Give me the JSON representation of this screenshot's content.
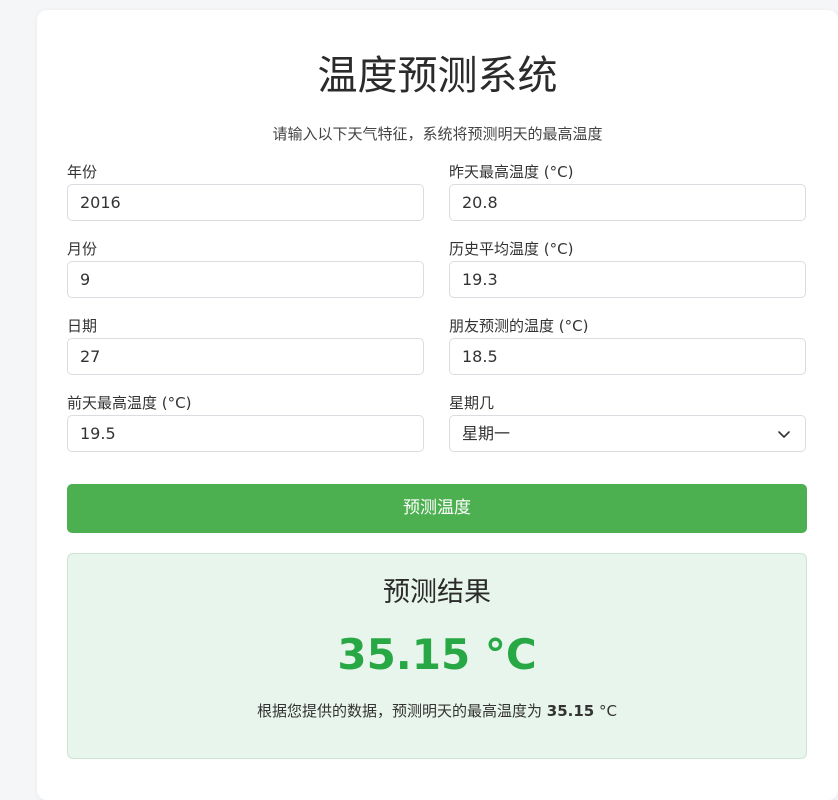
{
  "header": {
    "title": "温度预测系统",
    "subtitle": "请输入以下天气特征，系统将预测明天的最高温度"
  },
  "form": {
    "year": {
      "label": "年份",
      "value": "2016"
    },
    "month": {
      "label": "月份",
      "value": "9"
    },
    "day": {
      "label": "日期",
      "value": "27"
    },
    "temp_2": {
      "label": "前天最高温度 (°C)",
      "value": "19.5"
    },
    "temp_1": {
      "label": "昨天最高温度 (°C)",
      "value": "20.8"
    },
    "average": {
      "label": "历史平均温度 (°C)",
      "value": "19.3"
    },
    "friend": {
      "label": "朋友预测的温度 (°C)",
      "value": "18.5"
    },
    "week": {
      "label": "星期几",
      "value": "星期一",
      "icon": "chevron-down-icon"
    }
  },
  "actions": {
    "predict_label": "预测温度"
  },
  "result": {
    "title": "预测结果",
    "value_display": "35.15 °C",
    "sentence_prefix": "根据您提供的数据，预测明天的最高温度为",
    "sentence_value": "35.15",
    "sentence_unit": "°C"
  },
  "colors": {
    "accent": "#4caf50",
    "result_value": "#28a745",
    "result_background": "#e8f5ec"
  }
}
